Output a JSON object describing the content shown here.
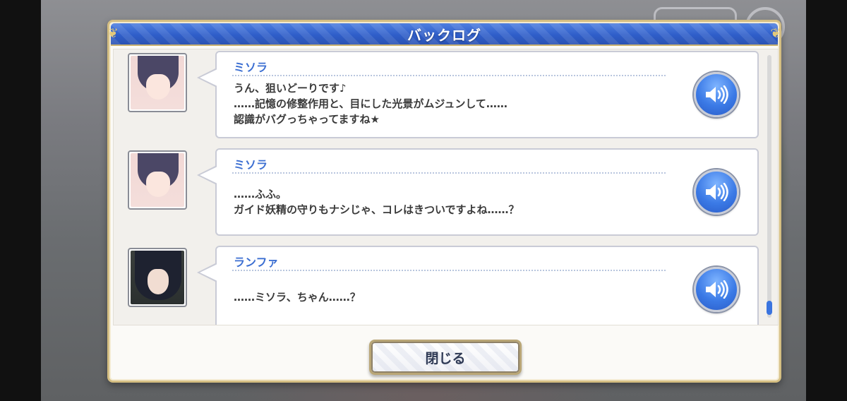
{
  "dialog": {
    "title": "バックログ",
    "close_label": "閉じる"
  },
  "entries": [
    {
      "speaker": "ミソラ",
      "avatar": "misora-portrait",
      "lines": [
        "うん、狙いどーりです♪",
        "……記憶の修整作用と、目にした光景がムジュンして……",
        "認識がバグっちゃってますね★"
      ]
    },
    {
      "speaker": "ミソラ",
      "avatar": "misora-portrait",
      "lines": [
        "……ふふ。",
        "ガイド妖精の守りもナシじゃ、コレはきついですよね……？"
      ]
    },
    {
      "speaker": "ランファ",
      "avatar": "lanfa-portrait",
      "lines": [
        "……ミソラ、ちゃん……？"
      ]
    }
  ],
  "icons": {
    "voice": "speaker-volume-icon"
  },
  "colors": {
    "title_bar": "#2f5ec9",
    "speaker_name": "#3c6fd2",
    "frame_gold": "#d5bf83",
    "voice_button": "#3b7ae6"
  }
}
